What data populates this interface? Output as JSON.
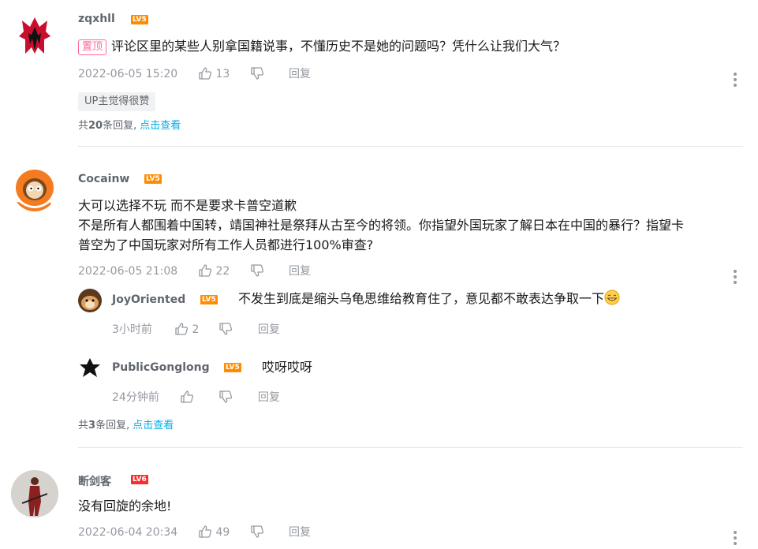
{
  "comments": [
    {
      "username": "zqxhll",
      "level": "LV5",
      "pinned_label": "置顶",
      "text": "评论区里的某些人别拿国籍说事，不懂历史不是她的问题吗？凭什么让我们大气？",
      "time": "2022-06-05 15:20",
      "likes": "13",
      "reply_label": "回复",
      "up_tag": "UP主觉得很赞",
      "reply_summary": {
        "prefix": "共",
        "count": "20",
        "suffix": "条回复,",
        "link": "点击查看"
      }
    },
    {
      "username": "Cocainw",
      "level": "LV5",
      "text_lines": [
        "大可以选择不玩 而不是要求卡普空道歉",
        "不是所有人都围着中国转，靖国神社是祭拜从古至今的将领。你指望外国玩家了解日本在中国的暴行？指望卡",
        "普空为了中国玩家对所有工作人员都进行100%审查?"
      ],
      "time": "2022-06-05 21:08",
      "likes": "22",
      "reply_label": "回复",
      "replies": [
        {
          "username": "JoyOriented",
          "level": "LV5",
          "text": "不发生到底是缩头乌龟思维给教育住了，意见都不敢表达争取一下",
          "emoji": "grin-emoji",
          "time": "3小时前",
          "likes": "2",
          "reply_label": "回复"
        },
        {
          "username": "PublicGonglong",
          "level": "LV5",
          "text": "哎呀哎呀",
          "time": "24分钟前",
          "likes": "",
          "reply_label": "回复"
        }
      ],
      "reply_summary": {
        "prefix": "共",
        "count": "3",
        "suffix": "条回复,",
        "link": "点击查看"
      }
    },
    {
      "username": "断剑客",
      "level": "LV6",
      "text": "没有回旋的余地!",
      "time": "2022-06-04 20:34",
      "likes": "49",
      "reply_label": "回复"
    }
  ],
  "colors": {
    "text_primary": "#18191c",
    "text_secondary": "#9499a0",
    "name": "#61666d",
    "link": "#00aeec",
    "pin": "#ff6699",
    "lv5": "#ff8c00",
    "lv6": "#ff2b2b"
  }
}
